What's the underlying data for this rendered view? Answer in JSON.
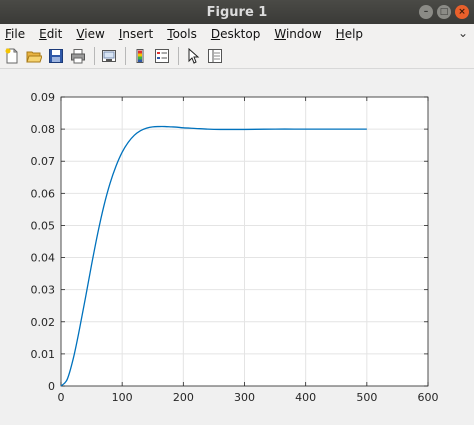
{
  "window": {
    "title": "Figure 1",
    "controls": {
      "minimize": "–",
      "maximize": "□",
      "close": "×"
    }
  },
  "menubar": {
    "items": [
      {
        "mnemonic": "F",
        "rest": "ile"
      },
      {
        "mnemonic": "E",
        "rest": "dit"
      },
      {
        "mnemonic": "V",
        "rest": "iew"
      },
      {
        "mnemonic": "I",
        "rest": "nsert"
      },
      {
        "mnemonic": "T",
        "rest": "ools"
      },
      {
        "mnemonic": "D",
        "rest": "esktop"
      },
      {
        "mnemonic": "W",
        "rest": "indow"
      },
      {
        "mnemonic": "H",
        "rest": "elp"
      }
    ],
    "overflow_icon": "chevron-down-icon"
  },
  "toolbar": {
    "buttons": [
      "new-figure-icon",
      "open-file-icon",
      "save-icon",
      "print-icon",
      "link-plot-icon",
      "colorbar-icon",
      "legend-icon",
      "select-pointer-icon",
      "property-editor-icon"
    ]
  },
  "chart_data": {
    "type": "line",
    "title": "",
    "xlabel": "",
    "ylabel": "",
    "xlim": [
      0,
      600
    ],
    "ylim": [
      0,
      0.09
    ],
    "xticks": [
      0,
      100,
      200,
      300,
      400,
      500,
      600
    ],
    "yticks": [
      0,
      0.01,
      0.02,
      0.03,
      0.04,
      0.05,
      0.06,
      0.07,
      0.08,
      0.09
    ],
    "xtick_labels": [
      "0",
      "100",
      "200",
      "300",
      "400",
      "500",
      "600"
    ],
    "ytick_labels": [
      "0",
      "0.01",
      "0.02",
      "0.03",
      "0.04",
      "0.05",
      "0.06",
      "0.07",
      "0.08",
      "0.09"
    ],
    "grid": true,
    "series": [
      {
        "color": "#0072bd",
        "x": [
          0,
          10,
          20,
          30,
          40,
          50,
          60,
          70,
          80,
          90,
          100,
          110,
          120,
          130,
          140,
          150,
          160,
          170,
          180,
          190,
          200,
          220,
          240,
          260,
          280,
          300,
          350,
          400,
          450,
          500
        ],
        "y": [
          0,
          0.002,
          0.0085,
          0.0175,
          0.0275,
          0.0378,
          0.0475,
          0.056,
          0.063,
          0.0685,
          0.0728,
          0.0759,
          0.0781,
          0.0795,
          0.0803,
          0.0807,
          0.0808,
          0.0808,
          0.0807,
          0.0806,
          0.0804,
          0.0802,
          0.08,
          0.0799,
          0.0799,
          0.0799,
          0.08,
          0.08,
          0.08,
          0.08
        ]
      }
    ]
  }
}
